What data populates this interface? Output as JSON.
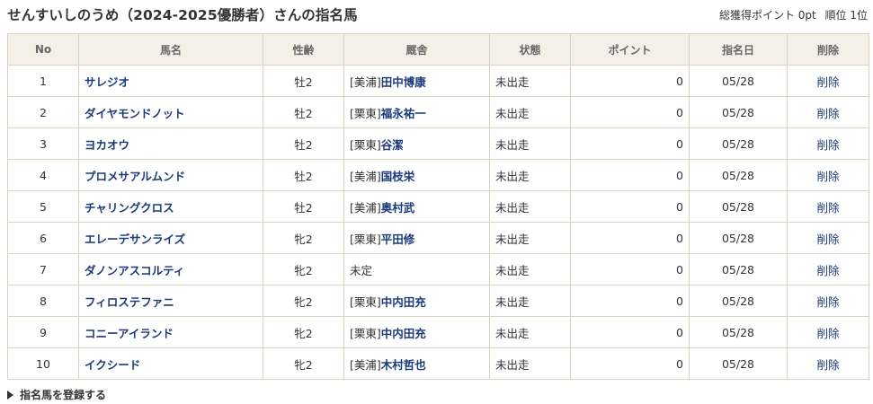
{
  "header": {
    "title": "せんすいしのうめ（2024-2025優勝者）さんの指名馬",
    "total_points": "総獲得ポイント 0pt",
    "rank": "順位 1位"
  },
  "table": {
    "columns": [
      "No",
      "馬名",
      "性齢",
      "厩舎",
      "状態",
      "ポイント",
      "指名日",
      "削除"
    ],
    "rows": [
      {
        "no": "1",
        "name": "サレジオ",
        "sex_age": "牡2",
        "stable_prefix": "[美浦]",
        "trainer": "田中博康",
        "status": "未出走",
        "points": "0",
        "date": "05/28",
        "delete": "削除"
      },
      {
        "no": "2",
        "name": "ダイヤモンドノット",
        "sex_age": "牡2",
        "stable_prefix": "[栗東]",
        "trainer": "福永祐一",
        "status": "未出走",
        "points": "0",
        "date": "05/28",
        "delete": "削除"
      },
      {
        "no": "3",
        "name": "ヨカオウ",
        "sex_age": "牡2",
        "stable_prefix": "[栗東]",
        "trainer": "谷潔",
        "status": "未出走",
        "points": "0",
        "date": "05/28",
        "delete": "削除"
      },
      {
        "no": "4",
        "name": "プロメサアルムンド",
        "sex_age": "牡2",
        "stable_prefix": "[美浦]",
        "trainer": "国枝栄",
        "status": "未出走",
        "points": "0",
        "date": "05/28",
        "delete": "削除"
      },
      {
        "no": "5",
        "name": "チャリングクロス",
        "sex_age": "牡2",
        "stable_prefix": "[美浦]",
        "trainer": "奥村武",
        "status": "未出走",
        "points": "0",
        "date": "05/28",
        "delete": "削除"
      },
      {
        "no": "6",
        "name": "エレーデサンライズ",
        "sex_age": "牝2",
        "stable_prefix": "[栗東]",
        "trainer": "平田修",
        "status": "未出走",
        "points": "0",
        "date": "05/28",
        "delete": "削除"
      },
      {
        "no": "7",
        "name": "ダノンアスコルティ",
        "sex_age": "牝2",
        "stable_prefix": "未定",
        "trainer": "",
        "status": "未出走",
        "points": "0",
        "date": "05/28",
        "delete": "削除"
      },
      {
        "no": "8",
        "name": "フィロステファニ",
        "sex_age": "牝2",
        "stable_prefix": "[栗東]",
        "trainer": "中内田充",
        "status": "未出走",
        "points": "0",
        "date": "05/28",
        "delete": "削除"
      },
      {
        "no": "9",
        "name": "コニーアイランド",
        "sex_age": "牝2",
        "stable_prefix": "[栗東]",
        "trainer": "中内田充",
        "status": "未出走",
        "points": "0",
        "date": "05/28",
        "delete": "削除"
      },
      {
        "no": "10",
        "name": "イクシード",
        "sex_age": "牝2",
        "stable_prefix": "[美浦]",
        "trainer": "木村哲也",
        "status": "未出走",
        "points": "0",
        "date": "05/28",
        "delete": "削除"
      }
    ]
  },
  "footer": {
    "register_label": "指名馬を登録する",
    "register_icon": "triangle-right-icon"
  },
  "colors": {
    "header_bg": "#f3f0e8",
    "border": "#d9d2c0",
    "link": "#1a3a7a"
  }
}
